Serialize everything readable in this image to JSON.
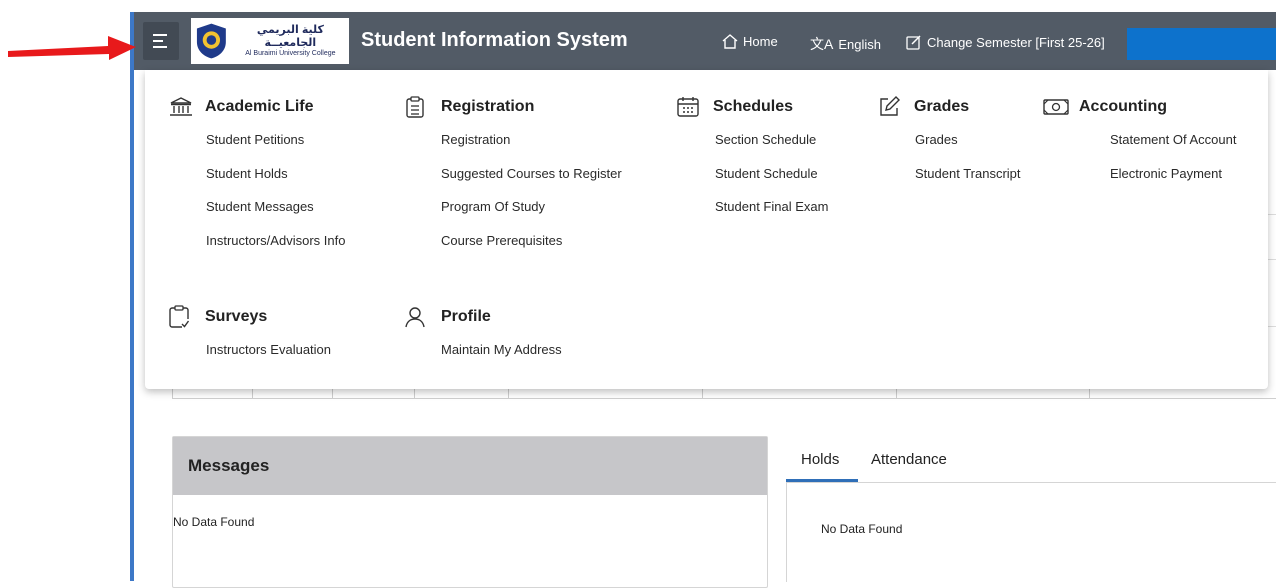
{
  "header": {
    "logo_arabic": "كلية البريمي الجامعيــة",
    "logo_english": "Al Buraimi University College",
    "app_title": "Student Information System",
    "home_label": "Home",
    "language_label": "English",
    "semester_label": "Change Semester [First 25-26]"
  },
  "colors": {
    "header_bg": "#525b66",
    "hamburger_bg": "#424a54",
    "user_box": "#0d72cc",
    "arrow": "#e8191b",
    "panel_head": "#c6c6c9",
    "tab_underline": "#2f6fb8"
  },
  "menu": {
    "academic_life": {
      "title": "Academic Life",
      "icon": "institution-icon",
      "items": [
        "Student Petitions",
        "Student Holds",
        "Student Messages",
        "Instructors/Advisors Info"
      ]
    },
    "registration": {
      "title": "Registration",
      "icon": "clipboard-list-icon",
      "items": [
        "Registration",
        "Suggested Courses to Register",
        "Program Of Study",
        "Course Prerequisites"
      ]
    },
    "schedules": {
      "title": "Schedules",
      "icon": "calendar-icon",
      "items": [
        "Section Schedule",
        "Student Schedule",
        "Student Final Exam"
      ]
    },
    "grades": {
      "title": "Grades",
      "icon": "edit-icon",
      "items": [
        "Grades",
        "Student Transcript"
      ]
    },
    "accounting": {
      "title": "Accounting",
      "icon": "money-icon",
      "items": [
        "Statement Of Account",
        "Electronic Payment"
      ]
    },
    "surveys": {
      "title": "Surveys",
      "icon": "clipboard-check-icon",
      "items": [
        "Instructors Evaluation"
      ]
    },
    "profile": {
      "title": "Profile",
      "icon": "user-icon",
      "items": [
        "Maintain My Address"
      ]
    }
  },
  "messages": {
    "title": "Messages",
    "empty": "No Data Found"
  },
  "tabs": {
    "holds": "Holds",
    "attendance": "Attendance",
    "holds_empty": "No Data Found"
  }
}
